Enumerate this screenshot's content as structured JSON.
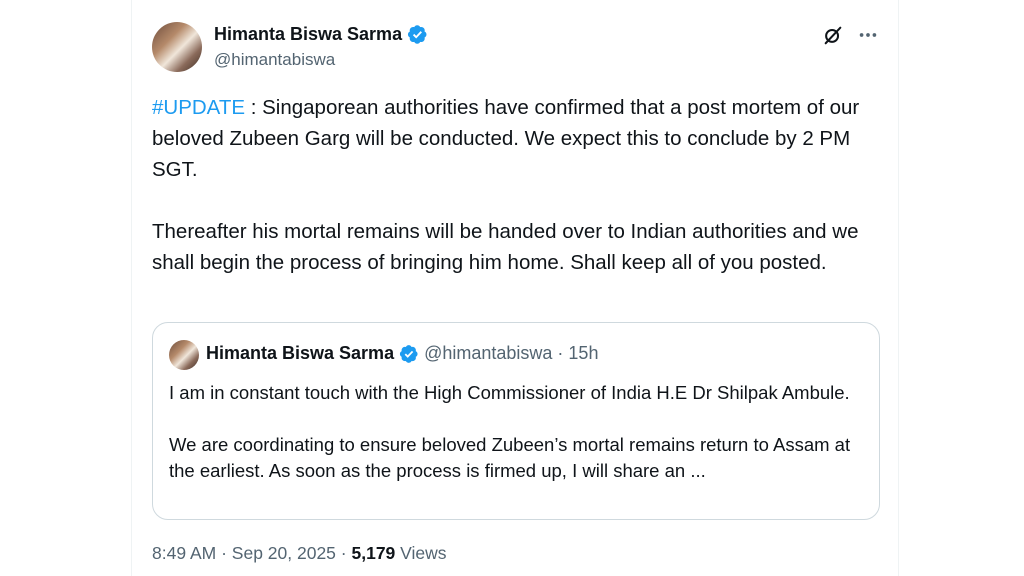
{
  "tweet": {
    "author_name": "Himanta Biswa Sarma",
    "handle": "@himantabiswa",
    "hashtag": "#UPDATE",
    "paragraph1_rest": " : Singaporean authorities have confirmed that a post mortem of our beloved Zubeen Garg will be conducted.  We expect this to conclude by 2 PM SGT.",
    "paragraph2": "Thereafter his mortal remains will be handed over to Indian authorities and we shall begin the process of bringing him home. Shall keep all of you posted.",
    "time": "8:49 AM",
    "date": "Sep 20, 2025",
    "separator": "·",
    "views_count": "5,179",
    "views_label": "Views"
  },
  "quote": {
    "author_name": "Himanta Biswa Sarma",
    "handle": "@himantabiswa",
    "separator": "·",
    "time_ago": "15h",
    "paragraph1": "I am in constant touch with the High Commissioner of India H.E Dr Shilpak Ambule.",
    "paragraph2": "We are coordinating to ensure beloved Zubeen’s mortal remains return to Assam at the earliest. As soon as the process is firmed up, I will share an ..."
  },
  "icons": {
    "verified": "verified-badge-icon",
    "grok": "grok-icon",
    "more": "more-options-icon"
  },
  "colors": {
    "accent": "#1d9bf0",
    "text": "#0f1419",
    "secondary": "#536471",
    "border": "#cfd9de"
  }
}
